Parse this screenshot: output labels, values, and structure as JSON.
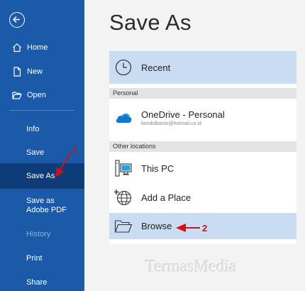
{
  "sidebar": {
    "back_icon": "arrow-left-circle-icon",
    "items": [
      {
        "label": "Home",
        "icon": "home-icon"
      },
      {
        "label": "New",
        "icon": "new-document-icon"
      },
      {
        "label": "Open",
        "icon": "open-folder-icon"
      },
      {
        "label": "Info"
      },
      {
        "label": "Save"
      },
      {
        "label": "Save As",
        "active": true
      },
      {
        "label": "Save as Adobe PDF"
      },
      {
        "label": "History",
        "disabled": true
      },
      {
        "label": "Print"
      },
      {
        "label": "Share"
      }
    ],
    "colors": {
      "background": "#1a5aa8",
      "active": "#0e3c78",
      "disabled_text": "#8eb0d8"
    }
  },
  "main": {
    "title": "Save As",
    "recent": {
      "label": "Recent",
      "icon": "clock-icon"
    },
    "sections": {
      "personal": "Personal",
      "other": "Other locations"
    },
    "onedrive": {
      "label": "OneDrive - Personal",
      "email": "bendolbantu@hotmail.co.id",
      "icon": "onedrive-cloud-icon"
    },
    "this_pc": {
      "label": "This PC",
      "icon": "computer-icon"
    },
    "add_place": {
      "label": "Add a Place",
      "icon": "globe-add-icon"
    },
    "browse": {
      "label": "Browse",
      "icon": "folder-icon"
    },
    "colors": {
      "highlight": "#cadcf1",
      "section_header": "#e3e3e3"
    }
  },
  "annotations": {
    "step1": "1",
    "step2": "2",
    "color": "#d0111b"
  },
  "watermark": "TermasMedia"
}
